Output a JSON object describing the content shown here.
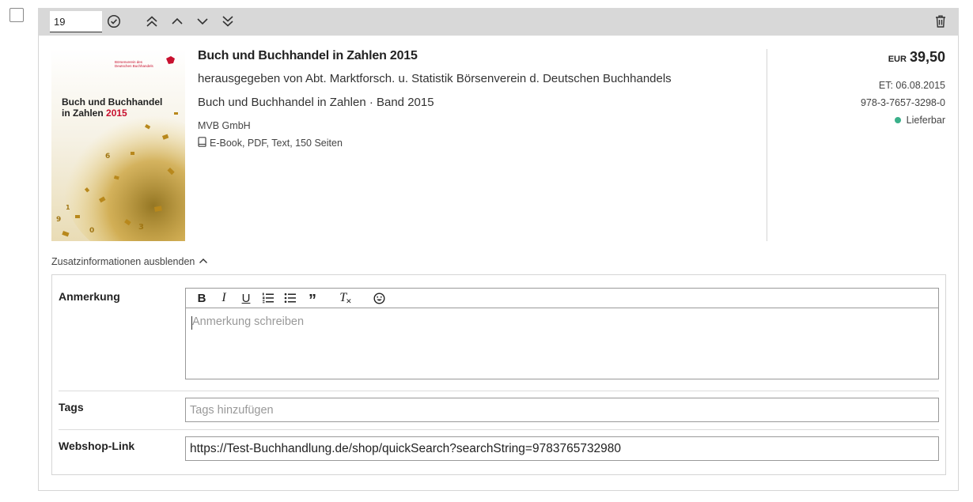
{
  "position": {
    "value": "19"
  },
  "book": {
    "title": "Buch und Buchhandel in Zahlen 2015",
    "editor": "herausgegeben von Abt. Marktforsch. u. Statistik Börsenverein d. Deutschen Buchhandels",
    "series": "Buch und Buchhandel in Zahlen · Band 2015",
    "publisher": "MVB GmbH",
    "format": "E-Book, PDF, Text, 150 Seiten",
    "cover": {
      "publisher_logo_line1": "Börsenverein des",
      "publisher_logo_line2": "Deutschen Buchhandels",
      "title_line1": "Buch und Buchhandel",
      "title_line2": "in Zahlen",
      "title_year": "2015"
    }
  },
  "pricing": {
    "currency": "EUR",
    "price": "39,50",
    "release": "ET: 06.08.2015",
    "isbn": "978-3-7657-3298-0",
    "availability": "Lieferbar",
    "availability_color": "#3ab08a"
  },
  "extra": {
    "toggle_label": "Zusatzinformationen ausblenden",
    "note": {
      "label": "Anmerkung",
      "placeholder": "Anmerkung schreiben"
    },
    "tags": {
      "label": "Tags",
      "placeholder": "Tags hinzufügen"
    },
    "webshop": {
      "label": "Webshop-Link",
      "value": "https://Test-Buchhandlung.de/shop/quickSearch?searchString=9783765732980"
    }
  },
  "editor_toolbar": {
    "bold": "B",
    "italic": "I",
    "underline": "U",
    "quote": "”",
    "clear": "T"
  },
  "icons": {
    "confirm": "check-circle-icon",
    "move_top": "double-chevron-up-icon",
    "move_up": "chevron-up-icon",
    "move_down": "chevron-down-icon",
    "move_bottom": "double-chevron-down-icon",
    "delete": "trash-icon"
  },
  "colors": {
    "toolbar_bg": "#d8d8d8",
    "accent_red": "#c8102e"
  }
}
